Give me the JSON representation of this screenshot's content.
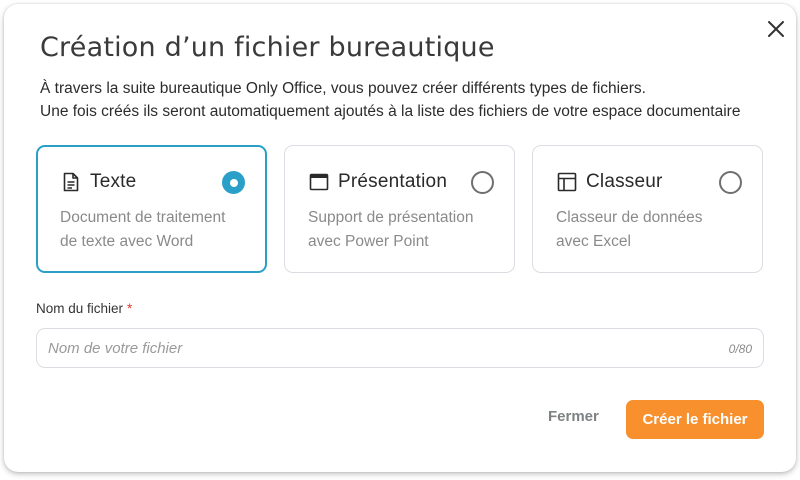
{
  "dialog": {
    "title": "Création d’un fichier bureautique",
    "description_line1": "À travers la suite bureautique Only Office, vous pouvez créer différents types de fichiers.",
    "description_line2": "Une fois créés ils seront automatiquement ajoutés à la liste des fichiers de votre espace documentaire",
    "close_icon": "close-icon"
  },
  "file_types": [
    {
      "label": "Texte",
      "desc_line1": "Document de traitement",
      "desc_line2": "de texte avec Word",
      "icon": "document-icon",
      "selected": true
    },
    {
      "label": "Présentation",
      "desc_line1": "Support de présentation",
      "desc_line2": "avec Power Point",
      "icon": "window-icon",
      "selected": false
    },
    {
      "label": "Classeur",
      "desc_line1": "Classeur de données",
      "desc_line2": "avec Excel",
      "icon": "spreadsheet-icon",
      "selected": false
    }
  ],
  "filename_field": {
    "label": "Nom du fichier",
    "required_mark": "*",
    "placeholder": "Nom de votre fichier",
    "value": "",
    "counter": "0/80"
  },
  "actions": {
    "cancel_label": "Fermer",
    "submit_label": "Créer le fichier"
  },
  "colors": {
    "accent": "#2aa0c8",
    "primary_button": "#f7902d",
    "required": "#e53935"
  }
}
